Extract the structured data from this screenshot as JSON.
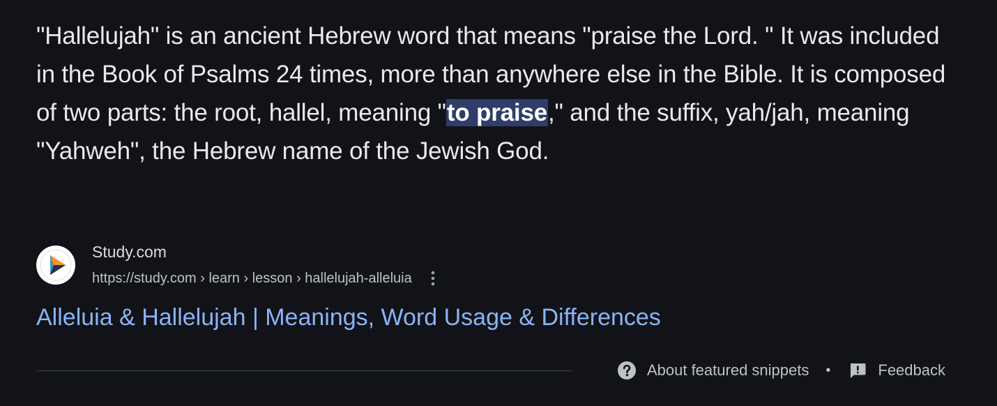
{
  "snippet": {
    "text_before": "\"Hallelujah\" is an ancient Hebrew word that means \"praise the Lord. \" It was included in the Book of Psalms 24 times, more than anywhere else in the Bible. It is composed of two parts: the root, hallel, meaning \"",
    "highlight": "to praise",
    "text_after": ",\" and the suffix, yah/jah, meaning \"Yahweh\", the Hebrew name of the Jewish God."
  },
  "source": {
    "site_name": "Study.com",
    "url": "https://study.com › learn › lesson › hallelujah-alleluia",
    "favicon_icon": "study-com-play-logo",
    "more_icon": "vertical-dots-icon"
  },
  "result": {
    "title": "Alleluia & Hallelujah | Meanings, Word Usage & Differences"
  },
  "footer": {
    "about_label": "About featured snippets",
    "separator": "•",
    "feedback_label": "Feedback",
    "about_icon": "help-circle-icon",
    "feedback_icon": "feedback-icon"
  },
  "colors": {
    "background": "#121318",
    "text": "#e8eaed",
    "highlight_bg": "#2f3d68",
    "link": "#8ab4f8",
    "muted": "#bdc1c6"
  }
}
